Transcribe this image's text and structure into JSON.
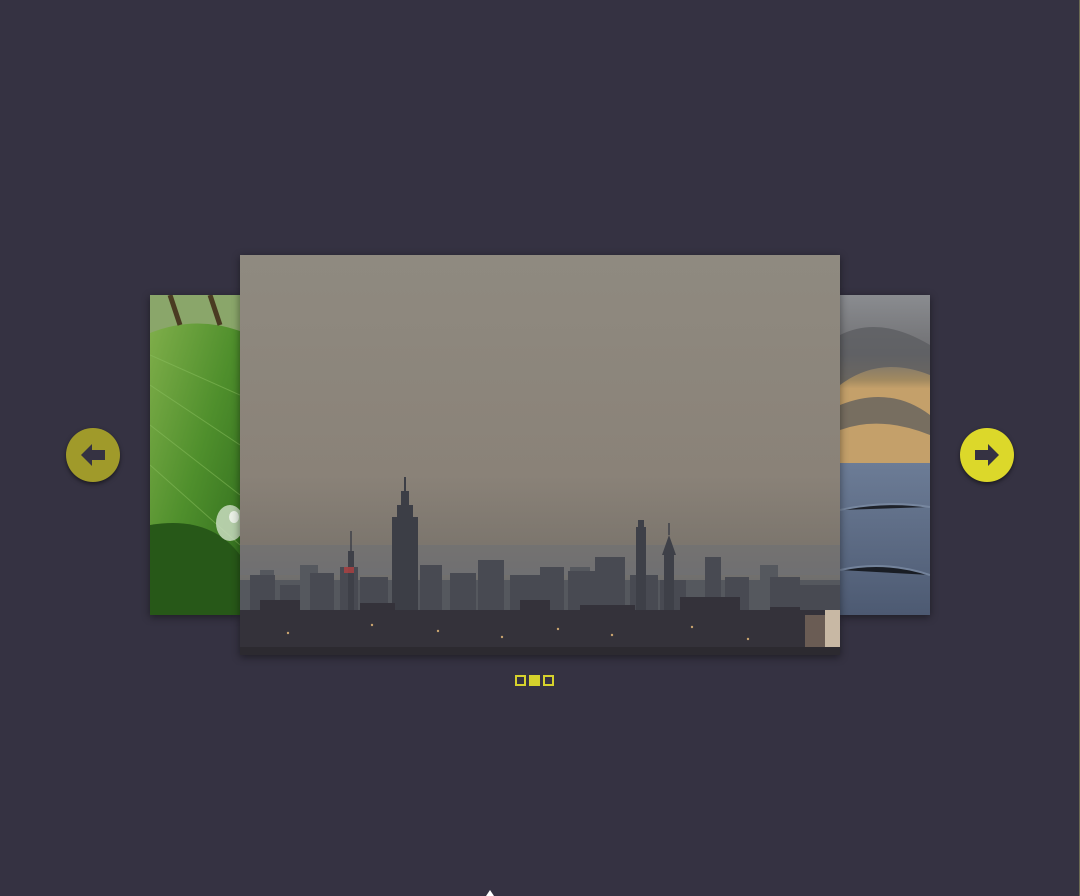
{
  "carousel": {
    "slides": [
      {
        "name": "leaf-slide",
        "icon": "leaf-image"
      },
      {
        "name": "city-skyline-slide",
        "icon": "skyline-image"
      },
      {
        "name": "sea-slide",
        "icon": "seascape-image"
      }
    ],
    "active_index": 1,
    "total_slides": 3,
    "prev_icon": "arrow-left-icon",
    "next_icon": "arrow-right-icon"
  },
  "colors": {
    "background": "#353242",
    "accent": "#dcd82a",
    "accent_dim": "#a09a2a"
  }
}
